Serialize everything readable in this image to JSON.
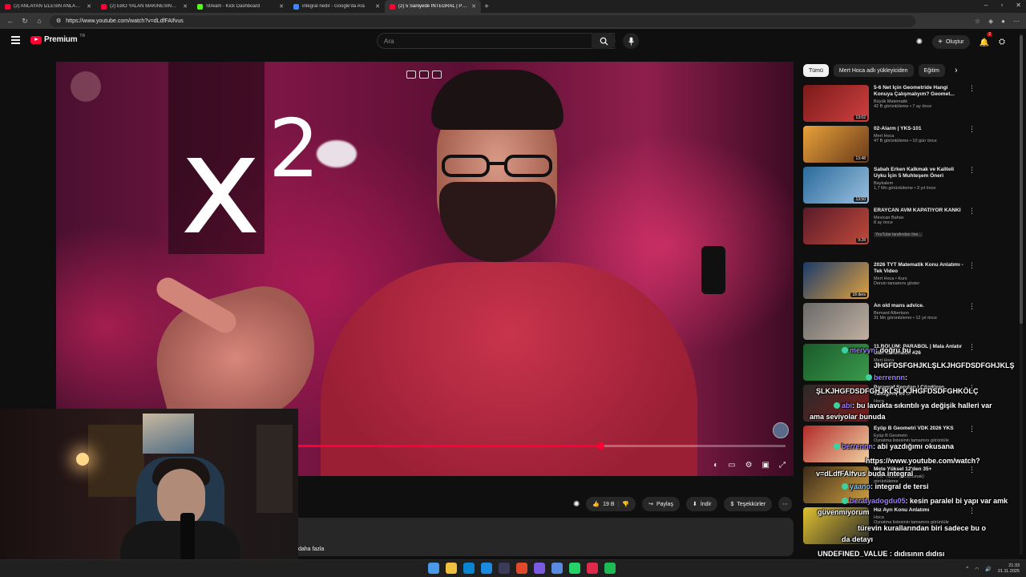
{
  "browser": {
    "tabs": [
      {
        "title": "(2) ANLAYAN İZLESİN ANLAMAYAN",
        "fav": "#ff0033",
        "active": false
      },
      {
        "title": "(2) EBO YALAN MAKİNESİNDE! H",
        "fav": "#ff0033",
        "active": false
      },
      {
        "title": "Stream - Kick Dashboard",
        "fav": "#53fc18",
        "active": false
      },
      {
        "title": "integral nedir - Google'da Ara",
        "fav": "#4285f4",
        "active": false
      },
      {
        "title": "(2) 5 Saniyede İNTEGRAL | PDF |",
        "fav": "#ff0033",
        "active": true
      }
    ],
    "new_tab": "+",
    "url": "https://www.youtube.com/watch?v=dLdfFAIfvus"
  },
  "header": {
    "logo_word": "Premium",
    "logo_region": "TR",
    "search_placeholder": "Ara",
    "create_label": "Oluştur",
    "notif_count": "2"
  },
  "video": {
    "math_base": "x",
    "math_exp": "2",
    "progress_fraction": 0.66
  },
  "actions": {
    "like_count": "19 B",
    "share": "Paylaş",
    "download": "İndir",
    "thanks": "Teşekkürler",
    "more_desc": "daha fazla"
  },
  "sidebar": {
    "chips": [
      "Tümü",
      "Mert Hoca adlı yükleyiciden",
      "Eğitim"
    ],
    "items": [
      {
        "title": "5-6 Net İçin Geometride Hangi Konuya Çalışmalıyım? Geomet...",
        "channel": "Büyük Matematik",
        "meta": "42 B görüntüleme • 7 ay önce",
        "duration": "13:02",
        "c1": "#7a1a1a",
        "c2": "#d04040",
        "extra": ""
      },
      {
        "title": "02-Alarm | YKS-101",
        "channel": "Mert Hoca",
        "meta": "47 B görüntüleme • 10 gün önce",
        "duration": "13:48",
        "c1": "#e8a23a",
        "c2": "#6a3a1a",
        "extra": ""
      },
      {
        "title": "Sabah Erken Kalkmak ve Kaliteli Uyku İçin 5 Muhteşem Öneri",
        "channel": "Baykalem",
        "meta": "1,7 Mn görüntüleme • 3 yıl önce",
        "duration": "13:50",
        "c1": "#2a6a9a",
        "c2": "#9ac0e0",
        "extra": ""
      },
      {
        "title": "ERAYCAN AVM KAPATIYOR KANKİ",
        "channel": "Mevican Bahav",
        "meta": "8 ay önce",
        "duration": "9:28",
        "c1": "#5a1a2a",
        "c2": "#c04a3a",
        "extra": "YouTube tarafından öne..."
      },
      {
        "title": "2026 TYT Matematik Konu Anlatımı - Tek Video",
        "channel": "Mert Hoca • Kurs",
        "meta": "Dersin tamamını göster",
        "duration": "18 ders",
        "c1": "#1a3a6a",
        "c2": "#e0a040",
        "extra": ""
      },
      {
        "title": "An old mans advice.",
        "channel": "Bernard Albertson",
        "meta": "31 Mn görüntüleme • 12 yıl önce",
        "duration": "",
        "c1": "#6a6a6a",
        "c2": "#c0b0a0",
        "extra": ""
      },
      {
        "title": "11.BÖLÜM: PARABOL | Mala Anlatır Gibi Matematik #26",
        "channel": "Mert Hoca",
        "meta": "2,8 B görüntüleme • 8 ay önce",
        "duration": "",
        "c1": "#1a5a2a",
        "c2": "#3a9a4a",
        "extra": ""
      },
      {
        "title": "Paragraf Soruları | Çözdüren Taktiğim | 25 ...",
        "channel": "Hoca",
        "meta": "görüntüleme • 1 yıl önce",
        "duration": "",
        "c1": "#2a2a2a",
        "c2": "#7a1a1a",
        "extra": ""
      },
      {
        "title": "Eyüp B Geometri VDK 2026 YKS",
        "channel": "Eyüp B Geometri",
        "meta": "Oynatma listesinin tamamını görüntüle",
        "duration": "",
        "c1": "#b02a2a",
        "c2": "#f0d0a0",
        "extra": ""
      },
      {
        "title": "Mete Yüksel 12'den 35+",
        "channel": "Mete Yüksel (5 Basamak)",
        "meta": "görüntüleme",
        "duration": "",
        "c1": "#3a2a1a",
        "c2": "#d0a040",
        "extra": ""
      },
      {
        "title": "Hız Ayrı Konu Anlatımı",
        "channel": "Hoca",
        "meta": "Oynatma listesinin tamamını görüntüle",
        "duration": "22 video",
        "c1": "#e0c030",
        "c2": "#2a2a2a",
        "extra": ""
      }
    ]
  },
  "chat": [
    {
      "user": "mervyn",
      "text": ": doğru bu"
    },
    {
      "user": "",
      "text": "JHGFDSFGHJKLŞLKJHGFDSDFGHJKLŞ"
    },
    {
      "user": "berrennn",
      "text": ":"
    },
    {
      "user": "",
      "text": "ŞLKJHGFDSDFGHJKLŞLKJHGFDSDFGHKÖLÇ"
    },
    {
      "user": "abi",
      "text": ": bu lavukta sıkıntılı ya değişik halleri var"
    },
    {
      "user": "",
      "text": "ama seviyolar bunuda"
    },
    {
      "user": "berrennn",
      "text": ": abi yazdığımı okusana"
    },
    {
      "user": "",
      "text": "https://www.youtube.com/watch?"
    },
    {
      "user": "",
      "text": "v=dLdfFAIfvus buda integral"
    },
    {
      "user": "yaano",
      "text": ": integral de tersi"
    },
    {
      "user": "beratyadogdu05",
      "text": ": kesin paralel bi yapı var amk"
    },
    {
      "user": "",
      "text": "güvenmiyorum"
    },
    {
      "user": "",
      "text": "türevin kurallarından biri sadece bu o"
    },
    {
      "user": "",
      "text": "da detayı"
    },
    {
      "user": "",
      "text": "UNDEFINED_VALUE : dıdısının dıdısı"
    },
    {
      "user": "berrennn",
      "text": ": ..."
    }
  ],
  "taskbar": {
    "icons": [
      "#4a9ae8",
      "#f0c040",
      "#0a84d0",
      "#1a8ae0",
      "#3a3a5a",
      "#e04a2a",
      "#7a5ae0",
      "#5a8ae0",
      "#25d366",
      "#e02a4a",
      "#1db954"
    ],
    "time": "21:33",
    "date": "21.11.2025"
  }
}
